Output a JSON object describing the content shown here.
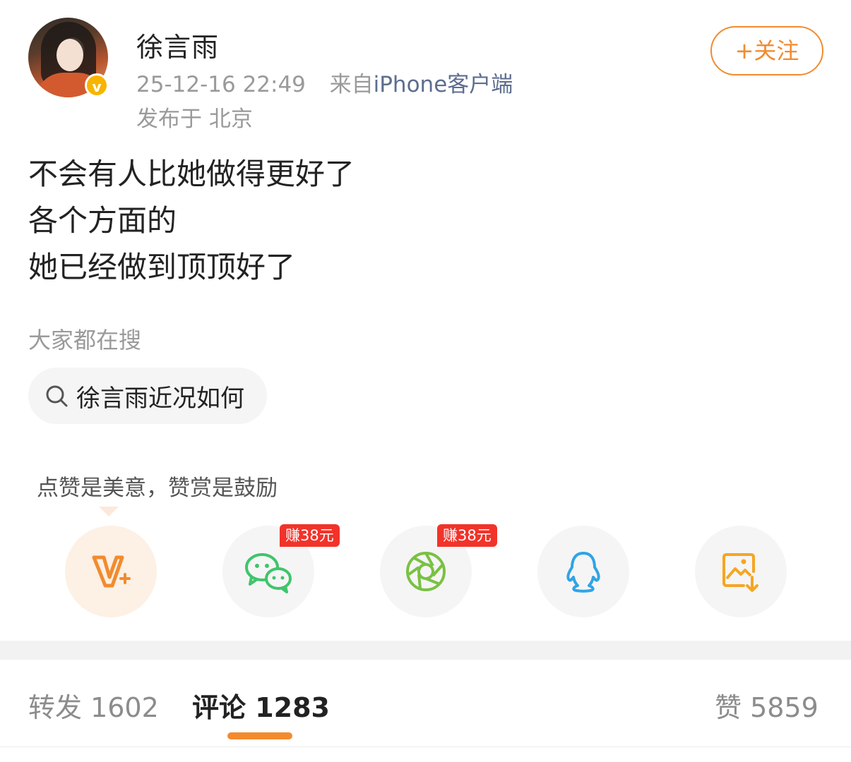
{
  "post": {
    "author": "徐言雨",
    "timestamp": "25-12-16 22:49",
    "source_prefix": "来自",
    "source": "iPhone客户端",
    "location": "发布于 北京",
    "follow_label": "+关注",
    "content_lines": [
      "不会有人比她做得更好了",
      "各个方面的",
      "她已经做到顶顶好了"
    ]
  },
  "search": {
    "title": "大家都在搜",
    "query": "徐言雨近况如何"
  },
  "reward": {
    "tip": "点赞是美意，赞赏是鼓励"
  },
  "share": {
    "items": [
      {
        "icon": "reward-v-icon",
        "badge": ""
      },
      {
        "icon": "wechat-icon",
        "badge": "赚38元"
      },
      {
        "icon": "moments-icon",
        "badge": "赚38元"
      },
      {
        "icon": "qq-icon",
        "badge": ""
      },
      {
        "icon": "save-image-icon",
        "badge": ""
      }
    ]
  },
  "tabs": {
    "repost": "转发 1602",
    "comment": "评论 1283",
    "like": "赞 5859"
  },
  "colors": {
    "accent": "#f28b2f",
    "badge": "#f2332a",
    "wechat": "#3fc56b",
    "moments": "#7ac143",
    "qq": "#2fa4e7",
    "save": "#f5a623"
  }
}
